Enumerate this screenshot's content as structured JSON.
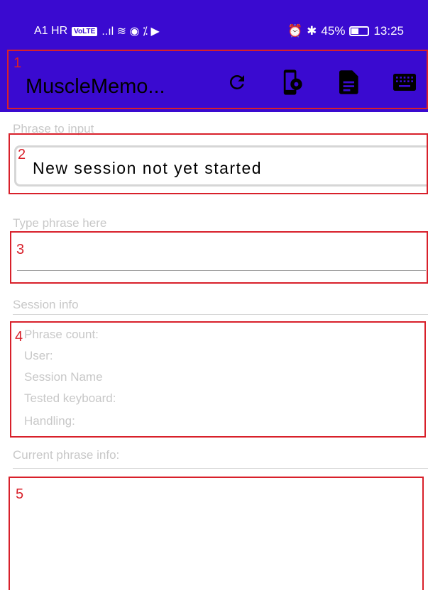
{
  "status_bar": {
    "carrier": "A1 HR",
    "volte": "VoLTE",
    "left_icons": "..ıl ≋ ◉ ⁒ ▶",
    "battery": "45%",
    "battery_level": 0.45,
    "time": "13:25"
  },
  "app_bar": {
    "title": "MuscleMemo...",
    "icons": [
      "refresh-icon",
      "phone-settings-icon",
      "document-icon",
      "keyboard-icon"
    ]
  },
  "phrase": {
    "label": "Phrase to input",
    "value": "New session not yet started"
  },
  "typing": {
    "label": "Type phrase here",
    "value": ""
  },
  "session": {
    "label": "Session info",
    "lines": [
      "Phrase count:",
      "User:",
      "Session Name",
      "Tested keyboard:",
      "Handling:"
    ]
  },
  "current": {
    "label": "Current phrase info:"
  },
  "box_labels": [
    "1",
    "2",
    "3",
    "4",
    "5"
  ],
  "colors": {
    "app_bar": "#3a0ad0",
    "annotation": "#d8202a",
    "hint_text": "#c8c8c8"
  }
}
